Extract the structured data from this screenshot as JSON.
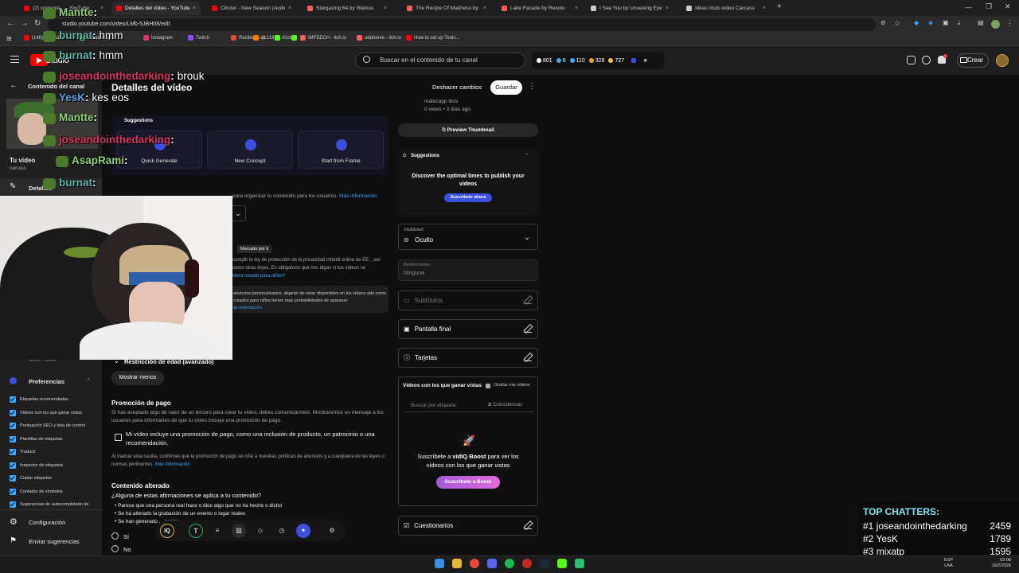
{
  "browser": {
    "tabs": [
      {
        "label": "(2) comenta... - YouTube",
        "color": "#ff0000"
      },
      {
        "label": "Detalles del vídeo - YouTube Studio",
        "color": "#ff0000"
      },
      {
        "label": "Clkster - New Season (Audio Official)",
        "color": "#ff0000"
      },
      {
        "label": "Stargazing 64 by Warkus",
        "color": "#fa5c5c"
      },
      {
        "label": "The Recipe Of Madness by zero",
        "color": "#fa5c5c"
      },
      {
        "label": "Lake Facade by Rexoto",
        "color": "#fa5c5c"
      },
      {
        "label": "I See You by Unseeing Eyes",
        "color": "#cccccc"
      },
      {
        "label": "Ideas título video Carcass",
        "color": "#cccccc"
      }
    ],
    "url": "studio.youtube.com/video/LMb-5JBH08/edit",
    "bookmarks": [
      {
        "label": "(146) YouTube",
        "color": "#ff0000"
      },
      {
        "label": "WhatsApp",
        "color": "#25d366"
      },
      {
        "label": "Instagram",
        "color": "#e1306c"
      },
      {
        "label": "Twitch",
        "color": "#9146ff"
      },
      {
        "label": "Recibidos (3.119) -...",
        "color": "#ea4335"
      },
      {
        "label": "sc",
        "color": "#ff7700"
      },
      {
        "label": "Kick",
        "color": "#53fc18"
      },
      {
        "label": "",
        "color": "#53fc18"
      },
      {
        "label": "IMFEECH - itch.io",
        "color": "#fa5c5c"
      },
      {
        "label": "oddnerve - itch.io",
        "color": "#fa5c5c"
      },
      {
        "label": "How to set up Tools...",
        "color": "#ff0000"
      }
    ]
  },
  "header": {
    "brand": "Studio",
    "search_placeholder": "Buscar en el contenido de tu canal",
    "stats": [
      {
        "value": "801",
        "color": "#ffffff"
      },
      {
        "value": "6",
        "color": "#3ea6ff"
      },
      {
        "value": "110",
        "color": "#3ea6ff"
      },
      {
        "value": "328",
        "color": "#f5a623"
      },
      {
        "value": "727",
        "color": "#f5c542"
      }
    ],
    "create_label": "Crear"
  },
  "sidebar": {
    "back_label": "Contenido del canal",
    "video_label": "Tu vídeo",
    "video_sub": "carcass",
    "details_label": "Detalles",
    "more_tools": "More Tools",
    "prefs_label": "Preferencias",
    "prefs": [
      "Etiquetas recomendadas",
      "Vídeos con los que ganar vistas",
      "Puntuación SEO y lista de control",
      "Plantillas de etiquetas",
      "Traducir",
      "Inspector de etiquetas",
      "Copiar etiquetas",
      "Contador de símbolos",
      "Sugerencias de autocompletado de"
    ],
    "settings_label": "Configuración",
    "feedback_label": "Enviar sugerencias"
  },
  "main": {
    "title": "Detalles del vídeo",
    "undo_label": "Deshacer cambios",
    "save_label": "Guardar",
    "suggestions_label": "Suggestions",
    "sug_cards": [
      "Quick Generate",
      "New Concept",
      "Start from Frame"
    ],
    "playlist_text": "para organizar tu contenido para los usuarios.",
    "playlist_link": "Más información",
    "marked_label": "Marcado por ti",
    "audience_text": "cumplir la ley de protección de la privacidad infantil online de EE. , así como otras leyes. Es obligatorio que nos digas si tus vídeos se",
    "audience_link": "idera creado para niños?",
    "ads_text": "anuncios personalizados, dejarán de estar disponibles en los vídeos ado como creados para niños tienen más probabilidades de aparecer",
    "ads_link": "ás información",
    "age_label": "Restricción de edad (avanzado)",
    "show_less": "Mostrar menos",
    "paid_title": "Promoción de pago",
    "paid_desc": "Si has aceptado algo de valor de un tercero para crear tu vídeo, debes comunicármelo. Mostraremos un mensaje a los usuarios para informarles de que tu vídeo incluye una promoción de pago.",
    "paid_check": "Mi vídeo incluye una promoción de pago, como una inclusión de producto, un patrocinio o una recomendación.",
    "paid_note": "Al marcar esta casilla, confirmas que la promoción de pago se ciñe a nuestras políticas de anuncios y a cualquiera de las leyes o normas pertinentes.",
    "paid_note_link": "Más información",
    "altered_title": "Contenido alterado",
    "altered_question": "¿Alguna de estas afirmaciones se aplica a tu contenido?",
    "altered_items": [
      "Parece que una persona real hace o dice algo que no ha hecho o dicho",
      "Se ha alterado la grabación de un evento o lugar reales",
      "Se han generado ... reales"
    ],
    "yes_label": "Sí",
    "no_label": "No"
  },
  "right": {
    "thumb_meta1": "matecapp ibos",
    "thumb_meta2": "0 views • 3 días ago",
    "preview_thumb": "Preview Thumbnail",
    "suggestions": "Suggestions",
    "publish_text": "Discover the optimal times to publish your videos",
    "subscribe_now": "Suscríbete ahora",
    "visibility_label": "Visibilidad",
    "visibility_value": "Oculto",
    "restrictions_label": "Restricciones",
    "restrictions_value": "Ninguna",
    "subtitles": "Subtítulos",
    "end_screen": "Pantalla final",
    "cards": "Tarjetas",
    "views_title": "Vídeos con los que ganar vistas",
    "hide_my_videos": "Ocultar mis vídeos",
    "search_tag": "Buscar por etiqueta",
    "matches": "Coincidencias",
    "boost_text_pre": "Suscríbete a ",
    "boost_text_bold": "vidIQ Boost",
    "boost_text_post": " para ver los vídeos con los que ganar vistas",
    "boost_btn": "Suscríbete a Boost",
    "quizzes": "Cuestionarios"
  },
  "chat": [
    {
      "user": "Mantte",
      "msg": "",
      "color": "#8fd17a"
    },
    {
      "user": "burnat",
      "msg": "hmm",
      "color": "#5fb5a8"
    },
    {
      "user": "burnat",
      "msg": "hmm",
      "color": "#5fb5a8"
    },
    {
      "user": "joseandointhedarking",
      "msg": "brouk",
      "color": "#d9355f"
    },
    {
      "user": "YesK",
      "msg": "kes eos",
      "color": "#5a9be8"
    },
    {
      "user": "Mantte",
      "msg": "",
      "color": "#8fd17a"
    },
    {
      "user": "joseandointhedarking",
      "msg": "",
      "color": "#d9355f"
    },
    {
      "user": "AsapRami",
      "msg": "",
      "color": "#8fd17a"
    },
    {
      "user": "burnat",
      "msg": "",
      "color": "#5fb5a8"
    }
  ],
  "top_chatters": {
    "title": "TOP CHATTERS:",
    "rows": [
      {
        "rank": "#1",
        "name": "joseandointhedarking",
        "count": "2459"
      },
      {
        "rank": "#2",
        "name": "YesK",
        "count": "1789"
      },
      {
        "rank": "#3",
        "name": "mixatp",
        "count": "1595"
      }
    ]
  },
  "taskbar": {
    "lang": "ESP\nLAA",
    "time": "02:08",
    "date": "19/2/2026"
  }
}
